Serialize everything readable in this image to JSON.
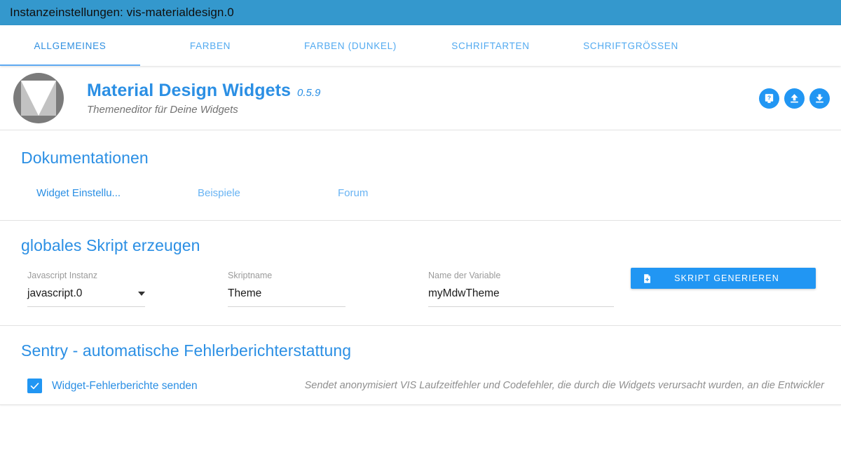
{
  "window": {
    "title": "Instanzeinstellungen: vis-materialdesign.0"
  },
  "tabs": [
    {
      "label": "ALLGEMEINES",
      "active": true
    },
    {
      "label": "FARBEN",
      "active": false
    },
    {
      "label": "FARBEN (DUNKEL)",
      "active": false
    },
    {
      "label": "SCHRIFTARTEN",
      "active": false
    },
    {
      "label": "SCHRIFTGRÖSSEN",
      "active": false
    }
  ],
  "app_header": {
    "logo_icon": "material-design-widgets-logo",
    "title": "Material Design Widgets",
    "version": "0.5.9",
    "subtitle": "Themeneditor für Deine Widgets",
    "buttons": [
      {
        "icon": "help-book-icon",
        "name": "help-button"
      },
      {
        "icon": "upload-icon",
        "name": "upload-button"
      },
      {
        "icon": "download-icon",
        "name": "download-button"
      }
    ]
  },
  "documentation": {
    "title": "Dokumentationen",
    "links": [
      {
        "label": "Widget Einstellu..."
      },
      {
        "label": "Beispiele"
      },
      {
        "label": "Forum"
      }
    ]
  },
  "script_section": {
    "title": "globales Skript erzeugen",
    "fields": [
      {
        "label": "Javascript Instanz",
        "value": "javascript.0",
        "type": "select"
      },
      {
        "label": "Skriptname",
        "value": "Theme",
        "type": "text"
      },
      {
        "label": "Name der Variable",
        "value": "myMdwTheme",
        "type": "text"
      }
    ],
    "generate_button": {
      "label": "SKRIPT GENERIEREN",
      "icon": "note-add-icon"
    }
  },
  "sentry_section": {
    "title": "Sentry - automatische Fehlerberichterstattung",
    "checkbox": {
      "label": "Widget-Fehlerberichte senden",
      "checked": true,
      "icon": "check-icon"
    },
    "hint": "Sendet anonymisiert VIS Laufzeitfehler und Codefehler, die durch die Widgets verursacht wurden, an die Entwickler"
  },
  "colors": {
    "titlebar_blue": "#3498cd",
    "accent_blue": "#2b8fe4",
    "button_blue": "#2196f3",
    "tab_blue": "#52aaf0",
    "muted_gray": "#8f8f8f"
  }
}
